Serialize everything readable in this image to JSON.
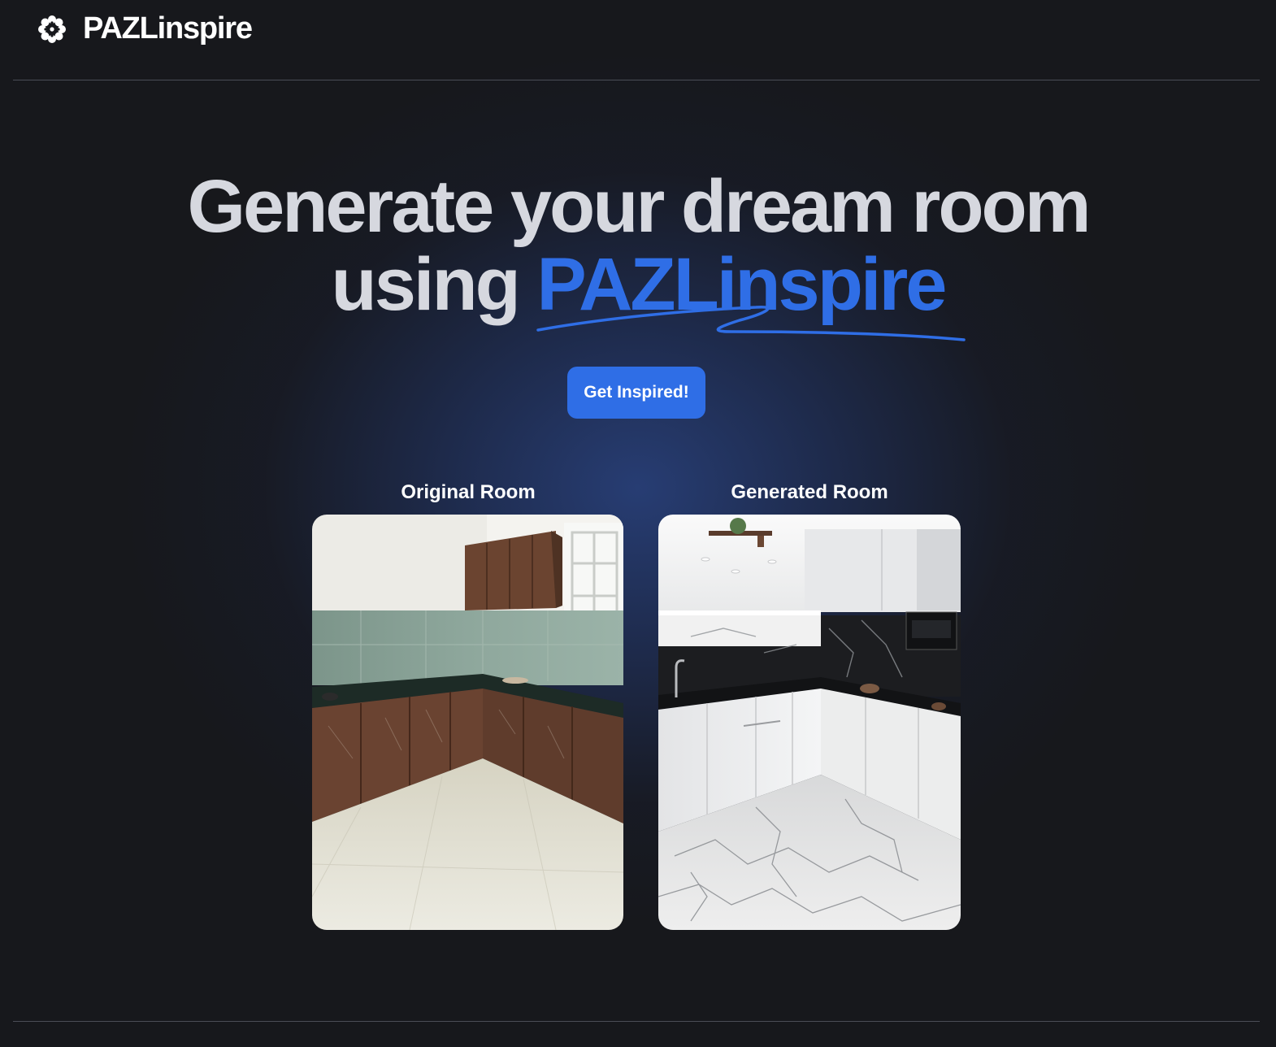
{
  "brand": {
    "name": "PAZLinspire",
    "icon": "flower-logo-icon"
  },
  "hero": {
    "title_line1": "Generate your dream room",
    "title_line2_prefix": "using ",
    "title_accent": "PAZLinspire",
    "cta_label": "Get Inspired!"
  },
  "comparison": {
    "original_label": "Original Room",
    "generated_label": "Generated Room"
  },
  "colors": {
    "background": "#17181c",
    "accent": "#2f6ee6",
    "title": "#d6d8df"
  }
}
